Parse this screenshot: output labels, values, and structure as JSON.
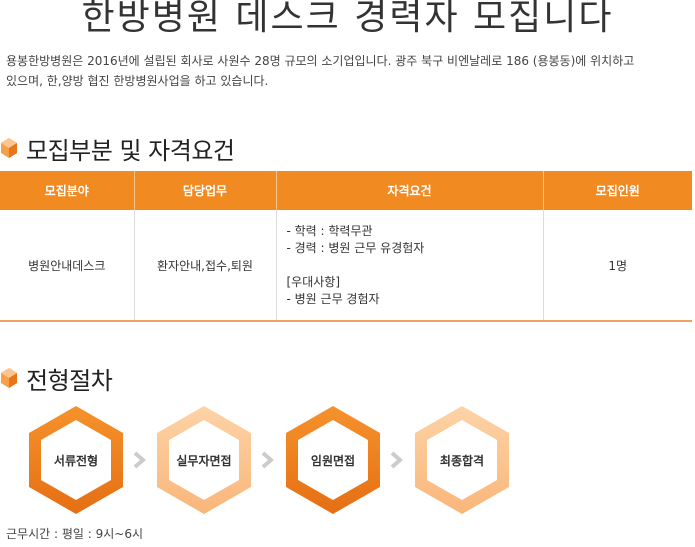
{
  "page": {
    "title": "한방병원 데스크 경력자 모집니다",
    "intro_line1": "용봉한방병원은 2016년에 설립된 회사로 사원수 28명 규모의 소기업입니다. 광주 북구 비엔날레로 186 (용봉동)에 위치하고",
    "intro_line2": "있으며, 한,양방 협진 한방병원사업을 하고 있습니다."
  },
  "recruit": {
    "section_title": "모집부분 및 자격요건",
    "headers": [
      "모집분야",
      "담당업무",
      "자격요건",
      "모집인원"
    ],
    "row": {
      "field": "병원안내데스크",
      "duties": "환자안내,접수,퇴원",
      "requirements": [
        "- 학력 : 학력무관",
        "- 경력 : 병원 근무 유경험자"
      ],
      "preferred": [
        "[우대사항]",
        "-  병원 근무 경험자"
      ],
      "count": "1명"
    }
  },
  "process": {
    "section_title": "전형절차",
    "steps": [
      "서류전형",
      "실무자면접",
      "임원면접",
      "최종합격"
    ],
    "arrow_icon": "chevron-right-icon"
  },
  "footer": {
    "hours": "근무시간 : 평일 : 9시~6시"
  },
  "colors": {
    "accent": "#f28a22",
    "accent_dark": "#e9751a",
    "accent_light": "#fbc58f",
    "arrow": "#cccccc"
  }
}
